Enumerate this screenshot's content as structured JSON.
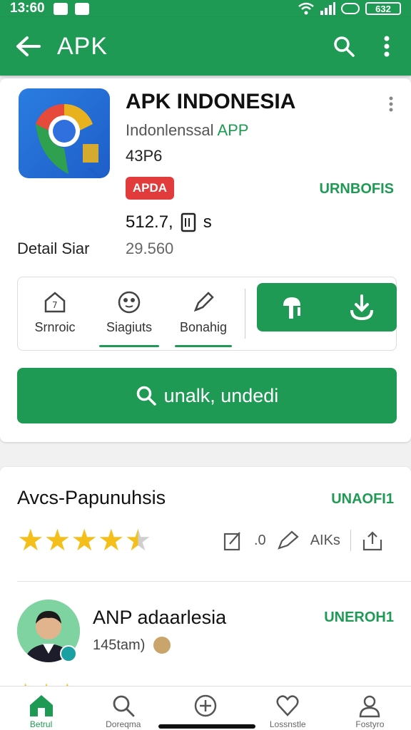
{
  "status": {
    "time": "13:60",
    "battery": "632"
  },
  "appbar": {
    "title": "APK"
  },
  "app": {
    "name": "APK INDONESIA",
    "developer_prefix": "Indonlenssal",
    "developer_accent": "APP",
    "size": "43P6",
    "badge": "APDA",
    "link": "URNBOFIS",
    "stat_value": "512.7,",
    "stat_suffix": "s",
    "detail_label": "Detail Siar",
    "detail_value": "29.560"
  },
  "actions": [
    {
      "label": "Srnroic"
    },
    {
      "label": "Siagiuts"
    },
    {
      "label": "Bonahig"
    }
  ],
  "big_button": {
    "label": "unalk, undedi"
  },
  "reviews": {
    "title": "Avcs-Papunuhsis",
    "link": "UNAOFI1",
    "rating": 4.5,
    "meta": {
      "count1": ".0",
      "count2": "AIKs"
    },
    "reviewer": {
      "name": "ANP adaarlesia",
      "sub": "145tam)",
      "link": "UNEROH1"
    }
  },
  "nav": [
    {
      "label": "Betrul",
      "icon": "home-icon"
    },
    {
      "label": "Doreqma",
      "icon": "search-icon"
    },
    {
      "label": "",
      "icon": "add-icon"
    },
    {
      "label": "Lossnstle",
      "icon": "favorite-icon"
    },
    {
      "label": "Fostyro",
      "icon": "profile-icon"
    }
  ],
  "colors": {
    "primary": "#1f9a54",
    "badge": "#e23b3b",
    "star": "#f5bf1b"
  }
}
